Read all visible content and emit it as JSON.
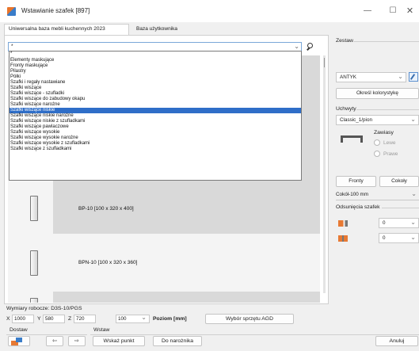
{
  "window": {
    "title": "Wstawianie szafek [897]",
    "controls": {
      "minimize": "—",
      "maximize": "☐",
      "close": "✕"
    }
  },
  "tabs": [
    {
      "label": "Uniwersalna baza mebli kuchennych 2023",
      "active": true
    },
    {
      "label": "Baza użytkownika",
      "active": false
    }
  ],
  "filter": {
    "value": "*",
    "chevron": "⌄"
  },
  "dropdown": {
    "items": [
      "*",
      "Elementy maskujące",
      "Fronty maskujące",
      "Pilastry",
      "Półki",
      "Szafki i regały nastawiane",
      "Szafki wiszące",
      "Szafki wiszące - szufladki",
      "Szafki wiszące do zabudowy okapu",
      "Szafki wiszące narożne",
      "Szafki wiszące niskie",
      "Szafki wiszące niskie narożne",
      "Szafki wiszące niskie z szufladkami",
      "Szafki wiszące pawlaczowe",
      "Szafki wiszące wysokie",
      "Szafki wiszące wysokie narożne",
      "Szafki wiszące wysokie z szufladkami",
      "Szafki wiszące z szufladkami"
    ],
    "selected_index": 10
  },
  "products": [
    {
      "label": "BP-10  [100 x 320 x 400]"
    },
    {
      "label": "BPN-10  [100 x 320 x 360]"
    }
  ],
  "side": {
    "zestaw_label": "Zestaw",
    "zestaw_value": "ANTYK",
    "okresl_button": "Określ kolorystykę",
    "uchwyty_label": "Uchwyty",
    "uchwyty_value": "Classic_1/pion",
    "zawiasy_label": "Zawiasy",
    "lewe_label": "Lewe",
    "prawe_label": "Prawe",
    "fronty_button": "Fronty",
    "cokoly_button": "Cokoły",
    "cokol_value": "Cokół-100 mm",
    "odsuniecia_label": "Odsunięcia szafek",
    "odsuniecie1_value": "0",
    "odsuniecie2_value": "0",
    "chevron": "⌄"
  },
  "bottom": {
    "wymiary_label": "Wymiary robocze: D3S-10/PGS",
    "x_label": "X",
    "x_value": "1000",
    "y_label": "Y",
    "y_value": "580",
    "z_label": "Z",
    "z_value": "720",
    "poziom_value": "100",
    "poziom_label": "Poziom [mm]",
    "agd_button": "Wybór sprzętu AGD",
    "dostaw_label": "Dostaw",
    "wstaw_label": "Wstaw",
    "arrow_left": "⇦",
    "arrow_right": "⇨",
    "wskaz_button": "Wskaż punkt",
    "do_naroznika_button": "Do narożnika",
    "anuluj_button": "Anuluj"
  },
  "colors": {
    "accent": "#2f6ec8",
    "orange": "#e77933",
    "blue": "#3a7dc9"
  }
}
